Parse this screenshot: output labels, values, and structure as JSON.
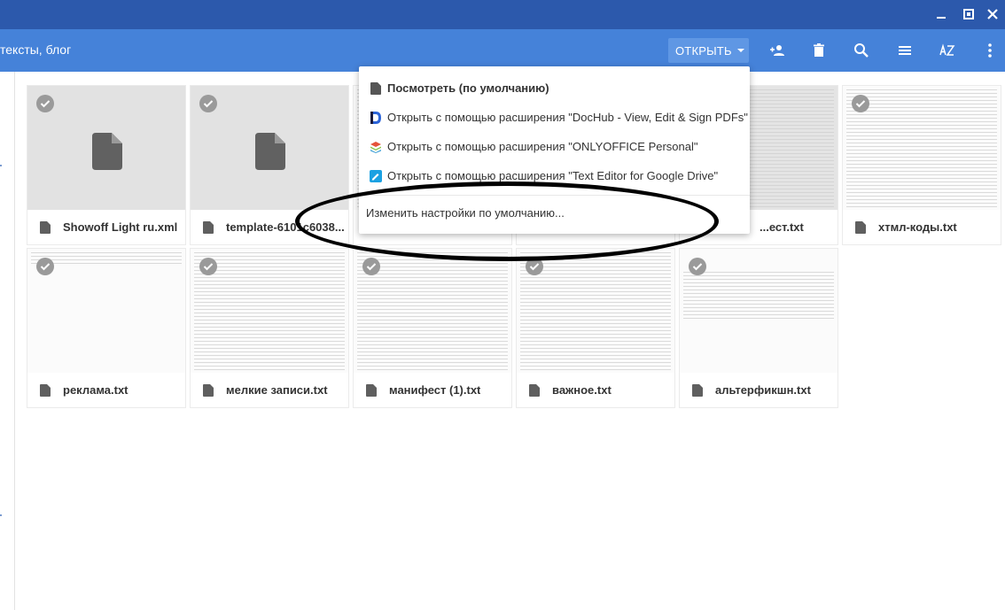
{
  "window": {
    "controls": [
      "minimize-icon",
      "restore-icon",
      "close-icon"
    ]
  },
  "toolbar": {
    "breadcrumb": "тексты, блог",
    "open_label": "ОТКРЫТЬ",
    "icons": [
      "add-person-icon",
      "trash-icon",
      "search-icon",
      "list-view-icon",
      "sort-az-icon",
      "more-vert-icon"
    ]
  },
  "open_menu": {
    "items": [
      {
        "label": "Посмотреть (по умолчанию)",
        "icon": "file-icon"
      },
      {
        "label": "Открыть с помощью расширения \"DocHub - View, Edit & Sign PDFs\"",
        "icon": "dochub-icon"
      },
      {
        "label": "Открыть с помощью расширения \"ONLYOFFICE Personal\"",
        "icon": "onlyoffice-icon"
      },
      {
        "label": "Открыть с помощью расширения \"Text Editor for Google Drive\"",
        "icon": "text-editor-icon"
      }
    ],
    "change_default": "Изменить настройки по умолчанию..."
  },
  "files": {
    "row1": [
      {
        "name": "Showoff Light ru.xml"
      },
      {
        "name": "template-6101c6038..."
      },
      {
        "name": ""
      },
      {
        "name": ""
      },
      {
        "name": "...ест.txt"
      },
      {
        "name": "хтмл-коды.txt"
      }
    ],
    "row2": [
      {
        "name": "реклама.txt"
      },
      {
        "name": "мелкие записи.txt"
      },
      {
        "name": "манифест (1).txt"
      },
      {
        "name": "важное.txt"
      },
      {
        "name": "альтерфикшн.txt"
      }
    ]
  },
  "colors": {
    "titlebar": "#2c59ac",
    "toolbar": "#4582d9",
    "open_button": "#5f97e4",
    "annotation_ellipse": "#000000"
  }
}
